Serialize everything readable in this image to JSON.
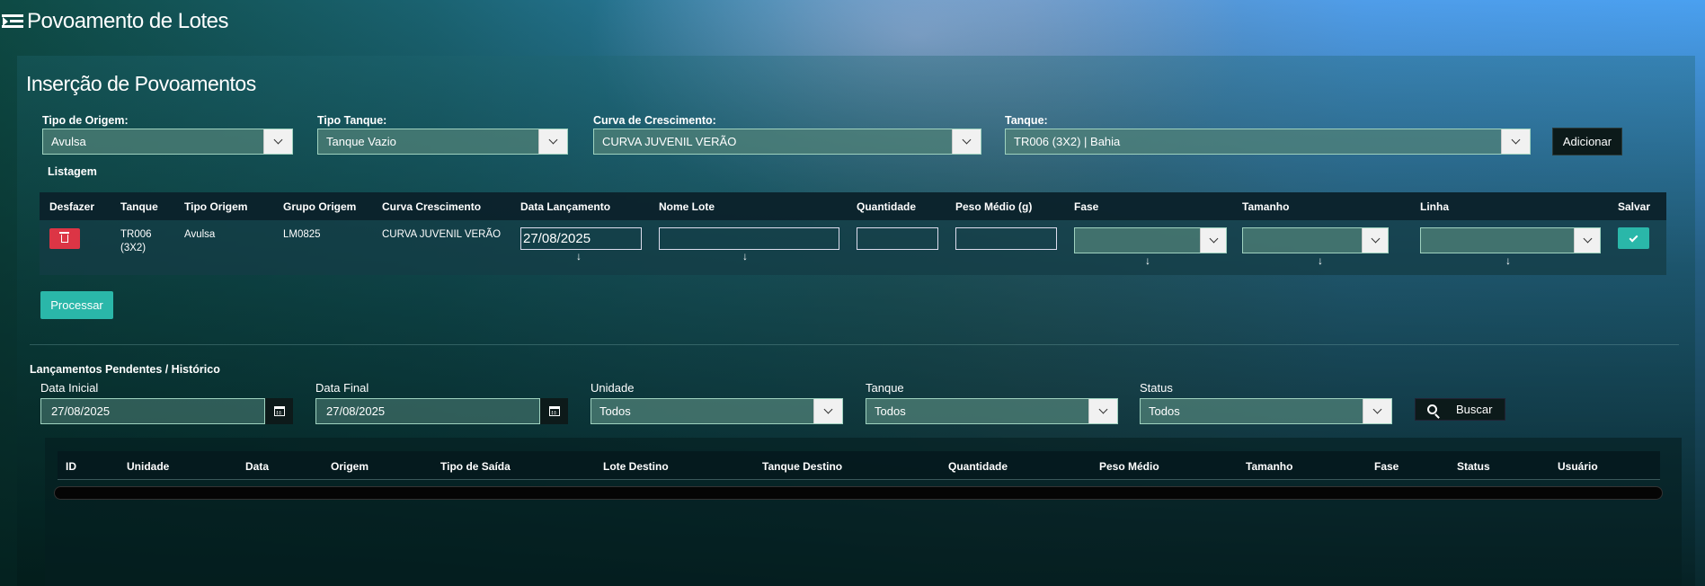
{
  "app": {
    "title": "Povoamento de Lotes"
  },
  "insercao": {
    "title": "Inserção de Povoamentos",
    "fields": {
      "tipo_origem": {
        "label": "Tipo de Origem:",
        "value": "Avulsa"
      },
      "tipo_tanque": {
        "label": "Tipo Tanque:",
        "value": "Tanque Vazio"
      },
      "curva": {
        "label": "Curva de Crescimento:",
        "value": "CURVA JUVENIL VERÃO"
      },
      "tanque": {
        "label": "Tanque:",
        "value": "TR006 (3X2) | Bahia"
      }
    },
    "add_button": "Adicionar",
    "listagem_label": "Listagem",
    "table": {
      "headers": [
        "Desfazer",
        "Tanque",
        "Tipo Origem",
        "Grupo Origem",
        "Curva Crescimento",
        "Data Lançamento",
        "Nome Lote",
        "Quantidade",
        "Peso Médio (g)",
        "Fase",
        "Tamanho",
        "Linha",
        "Salvar"
      ],
      "row": {
        "tanque_l1": "TR006",
        "tanque_l2": "(3X2)",
        "tipo_origem": "Avulsa",
        "grupo_origem": "LM0825",
        "curva": "CURVA JUVENIL VERÃO",
        "data": "27/08/2025",
        "nome_lote": "",
        "quantidade": "",
        "peso_medio": ""
      }
    },
    "processar_button": "Processar"
  },
  "historico": {
    "title": "Lançamentos Pendentes / Histórico",
    "filters": {
      "data_inicial": {
        "label": "Data Inicial",
        "value": "27/08/2025"
      },
      "data_final": {
        "label": "Data Final",
        "value": "27/08/2025"
      },
      "unidade": {
        "label": "Unidade",
        "value": "Todos"
      },
      "tanque": {
        "label": "Tanque",
        "value": "Todos"
      },
      "status": {
        "label": "Status",
        "value": "Todos"
      }
    },
    "buscar_button": "Buscar",
    "table": {
      "headers": [
        "ID",
        "Unidade",
        "Data",
        "Origem",
        "Tipo de Saída",
        "Lote Destino",
        "Tanque Destino",
        "Quantidade",
        "Peso Médio",
        "Tamanho",
        "Fase",
        "Status",
        "Usuário"
      ]
    }
  },
  "icons": {
    "menu": "menu-indent-icon",
    "trash": "trash-icon",
    "check": "check-icon",
    "calendar": "calendar-icon",
    "search": "search-icon",
    "arrow_down": "arrow-down-icon",
    "chevron": "chevron-down-icon"
  },
  "colors": {
    "accent_teal": "#2ab7a9",
    "danger": "#dc3545",
    "dark_button": "#0c1a1a"
  }
}
